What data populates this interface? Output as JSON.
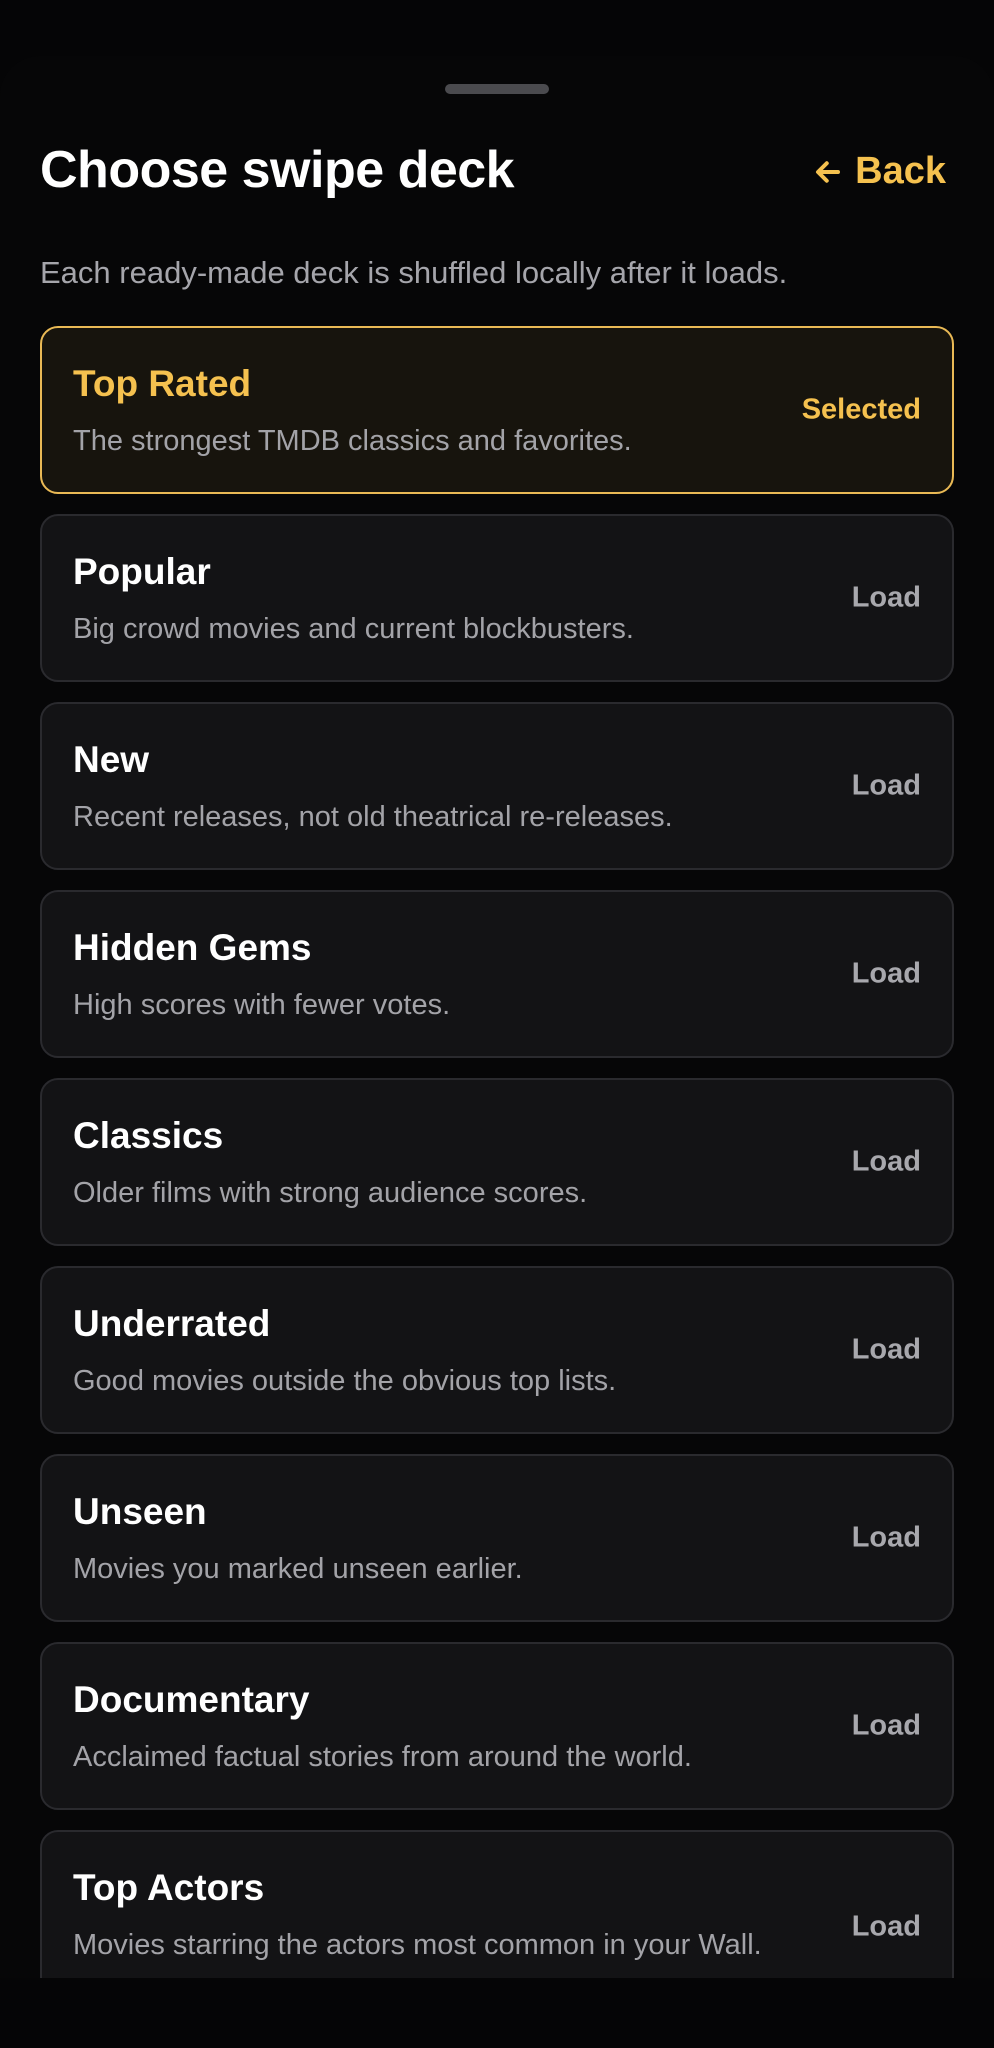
{
  "header": {
    "title": "Choose swipe deck",
    "back_label": "Back",
    "subtitle": "Each ready-made deck is shuffled locally after it loads."
  },
  "decks": [
    {
      "name": "Top Rated",
      "description": "The strongest TMDB classics and favorites.",
      "action": "Selected",
      "selected": true
    },
    {
      "name": "Popular",
      "description": "Big crowd movies and current blockbusters.",
      "action": "Load",
      "selected": false
    },
    {
      "name": "New",
      "description": "Recent releases, not old theatrical re-releases.",
      "action": "Load",
      "selected": false
    },
    {
      "name": "Hidden Gems",
      "description": "High scores with fewer votes.",
      "action": "Load",
      "selected": false
    },
    {
      "name": "Classics",
      "description": "Older films with strong audience scores.",
      "action": "Load",
      "selected": false
    },
    {
      "name": "Underrated",
      "description": "Good movies outside the obvious top lists.",
      "action": "Load",
      "selected": false
    },
    {
      "name": "Unseen",
      "description": "Movies you marked unseen earlier.",
      "action": "Load",
      "selected": false
    },
    {
      "name": "Documentary",
      "description": "Acclaimed factual stories from around the world.",
      "action": "Load",
      "selected": false
    },
    {
      "name": "Top Actors",
      "description": "Movies starring the actors most common in your Wall.",
      "action": "Load",
      "selected": false
    }
  ],
  "colors": {
    "accent": "#f5c14f",
    "background": "#060607",
    "card": "#131315",
    "card_border": "#2a2a2e"
  }
}
